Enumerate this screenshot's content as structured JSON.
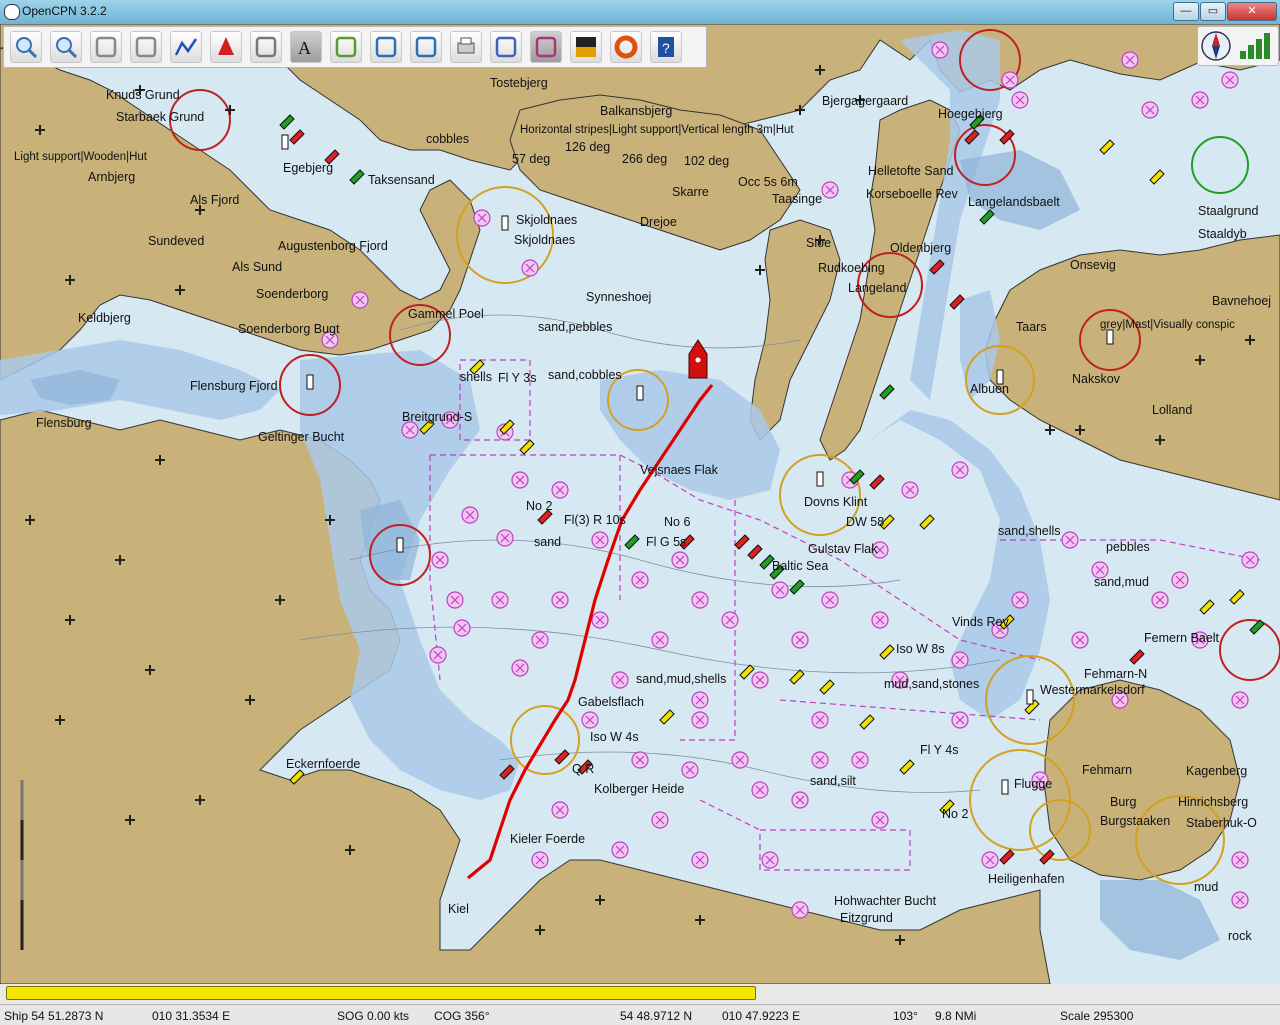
{
  "window": {
    "title": "OpenCPN 3.2.2",
    "minimize": "—",
    "restore": "▭",
    "close": "✕"
  },
  "toolbar": {
    "buttons": [
      {
        "name": "zoom-in-button",
        "icon": "zoom-in-icon"
      },
      {
        "name": "zoom-out-button",
        "icon": "zoom-out-icon"
      },
      {
        "name": "scale-in-button",
        "icon": "funnel-icon"
      },
      {
        "name": "scale-out-button",
        "icon": "cone-icon"
      },
      {
        "name": "route-button",
        "icon": "route-icon"
      },
      {
        "name": "auto-follow-button",
        "icon": "ship-icon"
      },
      {
        "name": "settings-button",
        "icon": "wrench-icon"
      },
      {
        "name": "text-button",
        "icon": "text-icon"
      },
      {
        "name": "current-button",
        "icon": "pencil-icon"
      },
      {
        "name": "tide-button",
        "icon": "tide-icon"
      },
      {
        "name": "layer-button",
        "icon": "layer-icon"
      },
      {
        "name": "print-button",
        "icon": "printer-icon"
      },
      {
        "name": "route-manager-button",
        "icon": "list-icon"
      },
      {
        "name": "track-button",
        "icon": "track-icon"
      },
      {
        "name": "color-scheme-button",
        "icon": "sun-icon"
      },
      {
        "name": "mob-button",
        "icon": "lifebuoy-icon"
      },
      {
        "name": "help-button",
        "icon": "help-icon"
      }
    ]
  },
  "colors": {
    "land": "#c9b27a",
    "deep": "#cfe3ee",
    "shallow": "#a8c8e6",
    "drying": "#8fb4d9",
    "track": "#e00000"
  },
  "map_labels": [
    {
      "t": "Tostebjerg"
    },
    {
      "t": "Balkansbjerg"
    },
    {
      "t": "Bjergagergaard"
    },
    {
      "t": "Hoegebjerg"
    },
    {
      "t": "Knuds Grund"
    },
    {
      "t": "Starbaek Grund"
    },
    {
      "t": "Egebjerg"
    },
    {
      "t": "Taksensand"
    },
    {
      "t": "Arnbjerg"
    },
    {
      "t": "Als Fjord"
    },
    {
      "t": "Sundeved"
    },
    {
      "t": "Augustenborg Fjord"
    },
    {
      "t": "Als Sund"
    },
    {
      "t": "Soenderborg"
    },
    {
      "t": "Keldbjerg"
    },
    {
      "t": "Soenderborg Bugt"
    },
    {
      "t": "Gammel Poel"
    },
    {
      "t": "Flensburg Fjord"
    },
    {
      "t": "Flensburg"
    },
    {
      "t": "Geltinger Bucht"
    },
    {
      "t": "Breitgrund-S"
    },
    {
      "t": "Skjoldnaes"
    },
    {
      "t": "Skjoldnaes"
    },
    {
      "t": "Drejoe"
    },
    {
      "t": "Sioe"
    },
    {
      "t": "Skarre"
    },
    {
      "t": "Synneshoej"
    },
    {
      "t": "Taasinge"
    },
    {
      "t": "Helletofte Sand"
    },
    {
      "t": "Korseboelle Rev"
    },
    {
      "t": "Langelandsbaelt"
    },
    {
      "t": "Rudkoebing"
    },
    {
      "t": "Langeland"
    },
    {
      "t": "Oldenbjerg"
    },
    {
      "t": "Onsevig"
    },
    {
      "t": "Staalgrund"
    },
    {
      "t": "Staaldyb"
    },
    {
      "t": "Bavnehoej"
    },
    {
      "t": "Taars"
    },
    {
      "t": "Albuen"
    },
    {
      "t": "Nakskov"
    },
    {
      "t": "Lolland"
    },
    {
      "t": "grey|Mast|Visually conspic"
    },
    {
      "t": "Vejsnaes Flak"
    },
    {
      "t": "Dovns Klint"
    },
    {
      "t": "Gulstav Flak"
    },
    {
      "t": "Baltic Sea"
    },
    {
      "t": "Vinds Rev"
    },
    {
      "t": "Femern Baelt"
    },
    {
      "t": "Fehmarn-N"
    },
    {
      "t": "Westermarkelsdorf"
    },
    {
      "t": "Fehmarn"
    },
    {
      "t": "Flugge"
    },
    {
      "t": "Burg"
    },
    {
      "t": "Burgstaaken"
    },
    {
      "t": "Staberhuk-O"
    },
    {
      "t": "Heiligenhafen"
    },
    {
      "t": "Kagenberg"
    },
    {
      "t": "Hinrichsberg"
    },
    {
      "t": "Gabelsflach"
    },
    {
      "t": "Kieler Foerde"
    },
    {
      "t": "Kolberger Heide"
    },
    {
      "t": "Kiel"
    },
    {
      "t": "Eckernfoerde"
    },
    {
      "t": "Hohwachter Bucht"
    },
    {
      "t": "Eitzgrund"
    },
    {
      "t": "Horizontal stripes|Light support|Vertical length 3m|Hut"
    },
    {
      "t": "Light support|Wooden|Hut"
    },
    {
      "t": "Occ 5s 6m"
    },
    {
      "t": "126 deg"
    },
    {
      "t": "266 deg"
    },
    {
      "t": "102 deg"
    },
    {
      "t": "57 deg"
    },
    {
      "t": "Fl Y 3s"
    },
    {
      "t": "Fl(3) R 10s"
    },
    {
      "t": "No 2"
    },
    {
      "t": "No 6"
    },
    {
      "t": "Fl G 5s"
    },
    {
      "t": "Iso W 4s"
    },
    {
      "t": "Iso W 8s"
    },
    {
      "t": "Fl Y 4s"
    },
    {
      "t": "DW 58"
    },
    {
      "t": "No 2"
    },
    {
      "t": "Q R"
    },
    {
      "t": "sand,cobbles"
    },
    {
      "t": "sand,pebbles"
    },
    {
      "t": "sand,shells"
    },
    {
      "t": "pebbles"
    },
    {
      "t": "sand,mud"
    },
    {
      "t": "sand,mud,shells"
    },
    {
      "t": "mud,sand,stones"
    },
    {
      "t": "sand,silt"
    },
    {
      "t": "mud"
    },
    {
      "t": "rock"
    },
    {
      "t": "shells"
    },
    {
      "t": "sand"
    },
    {
      "t": "cobbles"
    }
  ],
  "status": {
    "ship": "Ship 54 51.2873 N",
    "ship_lon": "010 31.3534 E",
    "sog": "SOG 0.00 kts",
    "cog": "COG 356°",
    "cursor_lat": "54 48.9712 N",
    "cursor_lon": "010 47.9223 E",
    "bearing": "103°",
    "distance": "9.8 NMi",
    "scale": "Scale 295300"
  },
  "progress": 0.59
}
